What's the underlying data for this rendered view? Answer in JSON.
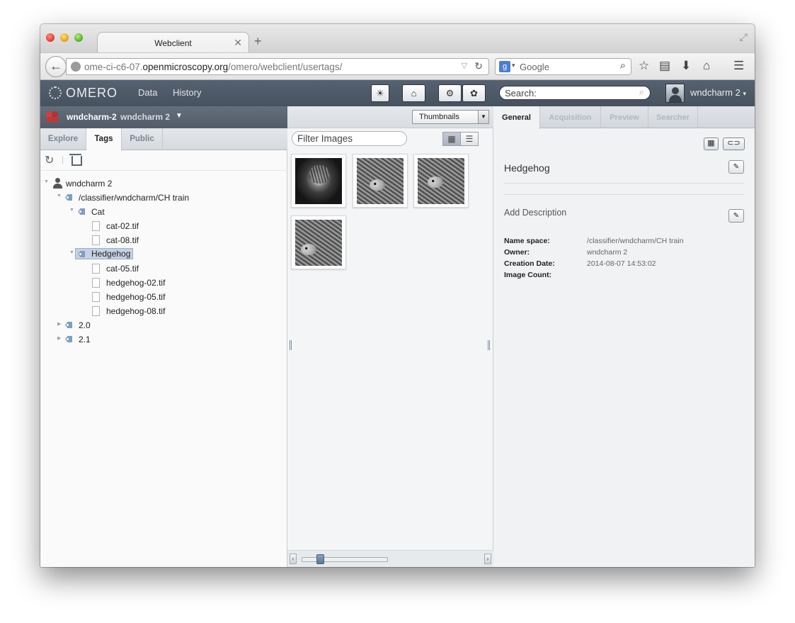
{
  "browser": {
    "tab_title": "Webclient",
    "url_prefix": "ome-ci-c6-07.",
    "url_domain": "openmicroscopy.org",
    "url_path": "/omero/webclient/usertags/",
    "search_engine": "Google",
    "search_placeholder": "Google"
  },
  "header": {
    "logo": "OMERO",
    "nav": [
      "Data",
      "History"
    ],
    "search_placeholder": "Search:",
    "user": "wndcharm 2",
    "accent": "#4f5a67"
  },
  "left": {
    "group_name": "wndcharm-2",
    "group_user": "wndcharm 2",
    "tabs": [
      "Explore",
      "Tags",
      "Public"
    ],
    "active_tab": "Tags",
    "tree": {
      "root": "wndcharm 2",
      "tagset": "/classifier/wndcharm/CH train",
      "cat": {
        "label": "Cat",
        "files": [
          "cat-02.tif",
          "cat-08.tif"
        ]
      },
      "hedgehog": {
        "label": "Hedgehog",
        "files": [
          "cat-05.tif",
          "hedgehog-02.tif",
          "hedgehog-05.tif",
          "hedgehog-08.tif"
        ]
      },
      "tag2": "2.0",
      "tag3": "2.1"
    }
  },
  "middle": {
    "view_select": "Thumbnails",
    "filter_placeholder": "Filter Images",
    "thumbnails": [
      "cat",
      "hedgehog",
      "hedgehog",
      "hedgehog"
    ],
    "zoom_fraction": 0.22
  },
  "right": {
    "tabs": [
      "General",
      "Acquisition",
      "Preview",
      "Searcher"
    ],
    "active_tab": "General",
    "title": "Hedgehog",
    "description_placeholder": "Add Description",
    "fields": [
      {
        "key": "Name space:",
        "value": "/classifier/wndcharm/CH train"
      },
      {
        "key": "Owner:",
        "value": "wndcharm 2"
      },
      {
        "key": "Creation Date:",
        "value": "2014-08-07 14:53:02"
      },
      {
        "key": "Image Count:",
        "value": ""
      }
    ]
  }
}
